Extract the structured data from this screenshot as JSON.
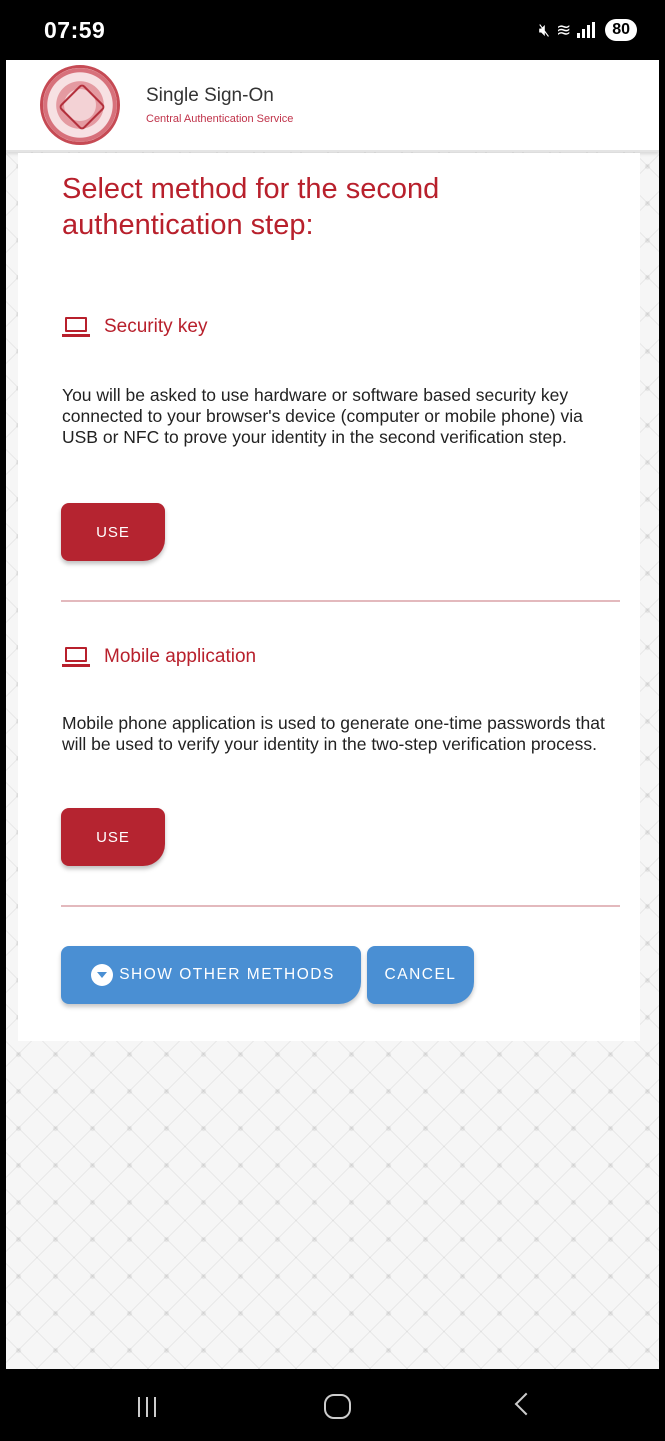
{
  "status_bar": {
    "time": "07:59",
    "battery": "80",
    "icons": [
      "mute-icon",
      "wifi-icon",
      "signal-icon"
    ]
  },
  "header": {
    "title": "Single Sign-On",
    "subtitle": "Central Authentication Service",
    "logo": "university-seal-logo"
  },
  "main": {
    "heading": "Select method for the second authentication step:",
    "methods": [
      {
        "title": "Security key",
        "icon": "laptop-icon",
        "description": "You will be asked to use hardware or software based security key connected to your browser's device (computer or mobile phone) via USB or NFC to prove your identity in the second verification step.",
        "button_label": "USE"
      },
      {
        "title": "Mobile application",
        "icon": "laptop-icon",
        "description": "Mobile phone application is used to generate one-time passwords that will be used to verify your identity in the two-step verification process.",
        "button_label": "USE"
      }
    ],
    "show_other_label": "SHOW OTHER METHODS",
    "cancel_label": "CANCEL"
  },
  "colors": {
    "accent": "#b8202c",
    "button_red": "#b52430",
    "button_blue": "#4a8fd3"
  },
  "nav_bar": {
    "icons": [
      "recent-apps-icon",
      "home-icon",
      "back-icon"
    ]
  }
}
